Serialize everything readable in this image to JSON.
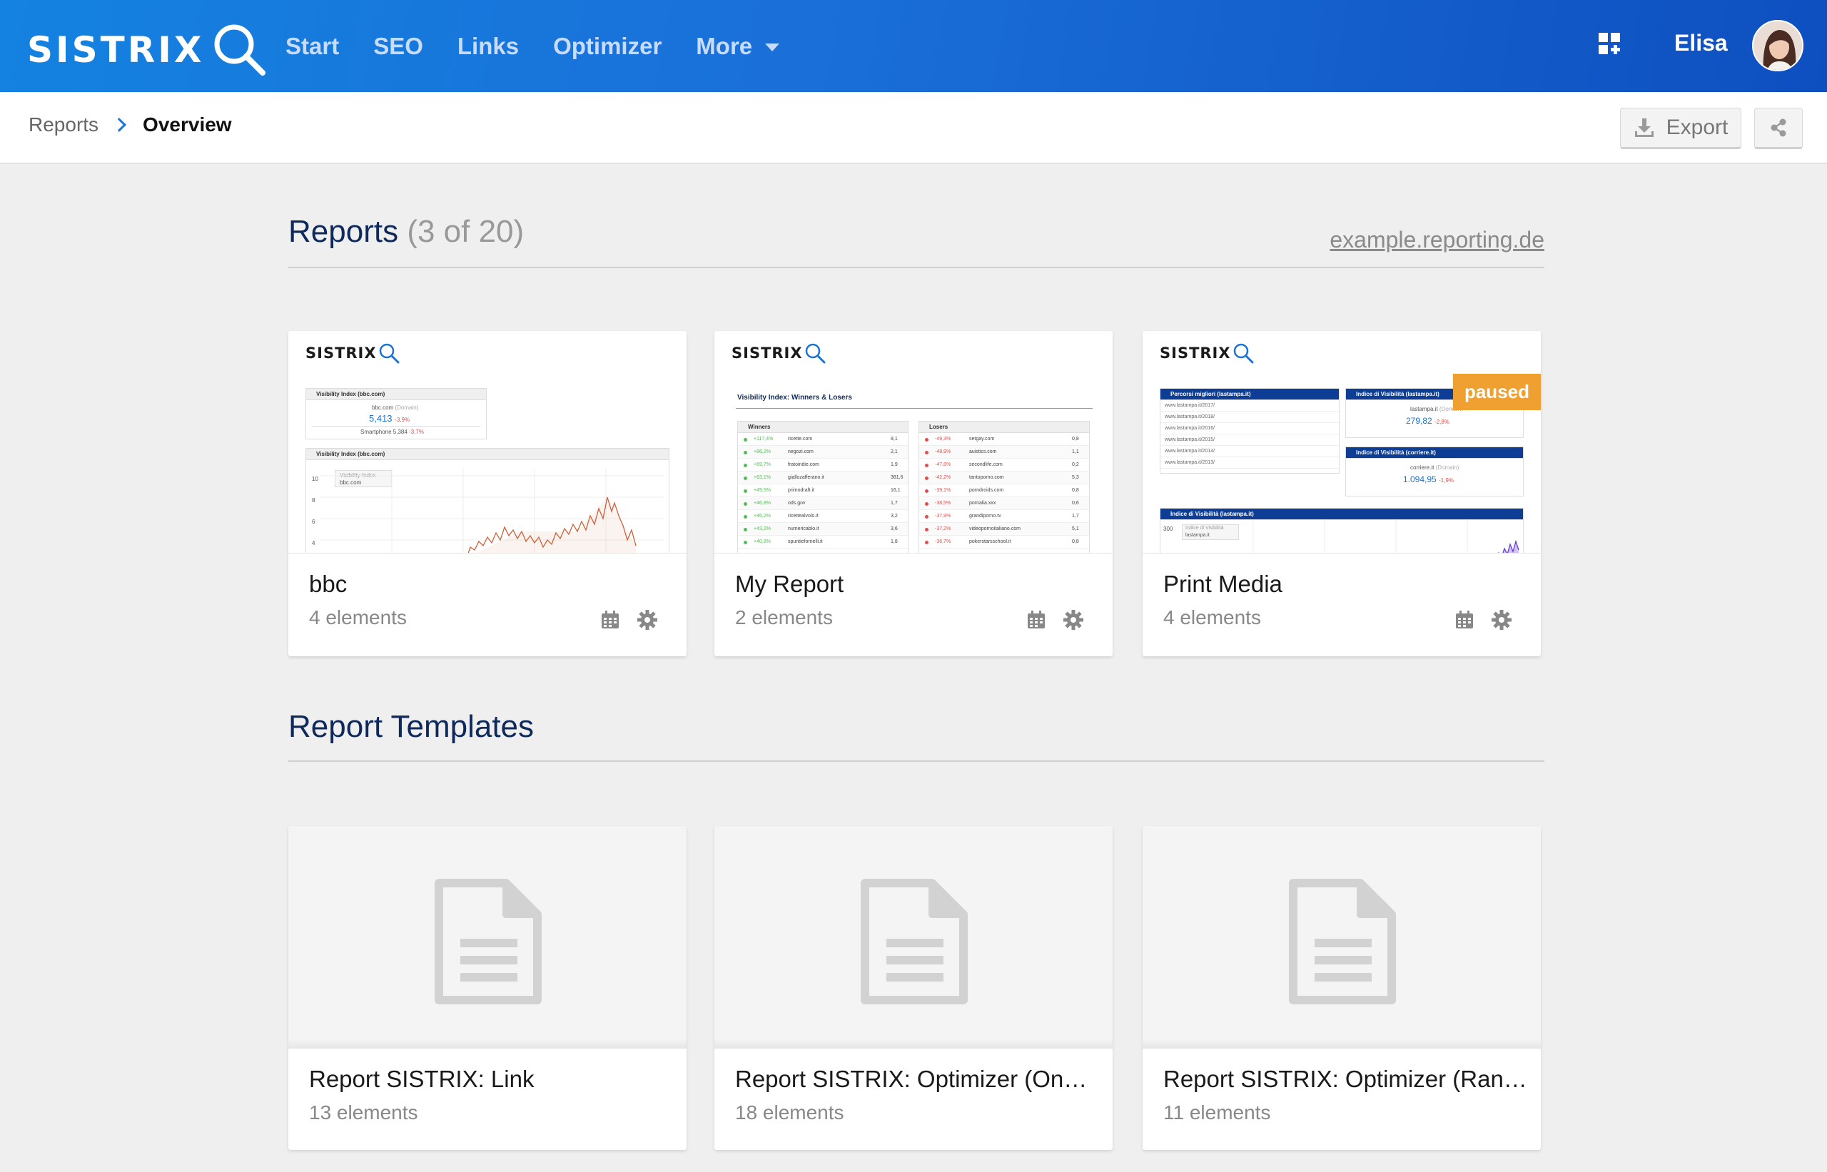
{
  "header": {
    "logo_text": "SISTRIX",
    "nav": [
      {
        "label": "Start"
      },
      {
        "label": "SEO"
      },
      {
        "label": "Links"
      },
      {
        "label": "Optimizer"
      },
      {
        "label": "More"
      }
    ],
    "user_name": "Elisa",
    "colors": {
      "gradient_start": "#1482e0",
      "gradient_end": "#0e4fc0"
    }
  },
  "breadcrumb": {
    "parent": "Reports",
    "current": "Overview"
  },
  "toolbar": {
    "export_label": "Export"
  },
  "reports_section": {
    "title": "Reports",
    "count": "(3 of 20)",
    "domain_link": "example.reporting.de",
    "cards": [
      {
        "title": "bbc",
        "subtitle": "4 elements",
        "thumb_logo": "SISTRIX"
      },
      {
        "title": "My Report",
        "subtitle": "2 elements",
        "thumb_logo": "SISTRIX"
      },
      {
        "title": "Print Media",
        "subtitle": "4 elements",
        "thumb_logo": "SISTRIX",
        "badge": "paused"
      }
    ]
  },
  "templates_section": {
    "title": "Report Templates",
    "cards": [
      {
        "title": "Report SISTRIX: Link",
        "subtitle": "13 elements"
      },
      {
        "title": "Report SISTRIX: Optimizer (Onpa…",
        "subtitle": "18 elements"
      },
      {
        "title": "Report SISTRIX: Optimizer (Ranki…",
        "subtitle": "11 elements"
      }
    ]
  },
  "thumbs": {
    "bbc": {
      "vi_header": "Visibility Index (bbc.com)",
      "domain": "bbc.com",
      "domain_note": "(Domain)",
      "value": "5,413",
      "change": "-3,9%",
      "smartphone": "Smartphone 5,384",
      "smartphone_change": "-3,7%",
      "chart_header": "Visibility Index (bbc.com)",
      "legend_title": "Visibility Index",
      "legend_series": "bbc.com",
      "y_ticks": [
        "10",
        "8",
        "6",
        "4"
      ]
    },
    "my_report": {
      "title": "Visibility Index: Winners & Losers",
      "winners_label": "Winners",
      "losers_label": "Losers",
      "winners": [
        [
          "+117,4%",
          "ricette.com",
          "8,1"
        ],
        [
          "+86,2%",
          "negozi.com",
          "2,1"
        ],
        [
          "+69,7%",
          "fratoindie.com",
          "1,9"
        ],
        [
          "+63,1%",
          "giallozafferano.it",
          "381,6"
        ],
        [
          "+49,5%",
          "primodraft.it",
          "16,1"
        ],
        [
          "+46,8%",
          "ods.gov",
          "1,7"
        ],
        [
          "+46,2%",
          "ricettealvolo.it",
          "3,2"
        ],
        [
          "+43,2%",
          "numericablo.it",
          "3,6"
        ],
        [
          "+40,8%",
          "spuntiefornelli.it",
          "1,8"
        ]
      ],
      "losers": [
        [
          "-49,3%",
          "setgay.com",
          "0,8"
        ],
        [
          "-48,9%",
          "auistics.com",
          "1,1"
        ],
        [
          "-47,8%",
          "secondlife.com",
          "0,2"
        ],
        [
          "-42,2%",
          "tantoporno.com",
          "5,3"
        ],
        [
          "-39,1%",
          "porndroids.com",
          "0,8"
        ],
        [
          "-38,5%",
          "pornalia.xxx",
          "0,6"
        ],
        [
          "-37,9%",
          "grandiporno.tv",
          "1,7"
        ],
        [
          "-37,2%",
          "videopornoitaliano.com",
          "5,1"
        ],
        [
          "-36,7%",
          "pokerstarsschool.it",
          "0,8"
        ]
      ]
    },
    "print_media": {
      "list_header": "Percorsi migliori (lastampa.it)",
      "list_rows": [
        "www.lastampa.it/2017/",
        "www.lastampa.it/2018/",
        "www.lastampa.it/2016/",
        "www.lastampa.it/2015/",
        "www.lastampa.it/2014/",
        "www.lastampa.it/2013/"
      ],
      "vi1_header": "Indice di Visibilità (lastampa.it)",
      "vi1_domain": "lastampa.it",
      "vi1_note": "(Domain)",
      "vi1_value": "279,82",
      "vi1_change": "-2,8%",
      "vi2_header": "Indice di Visibilità (corriere.it)",
      "vi2_domain": "corriere.it",
      "vi2_note": "(Domain)",
      "vi2_value": "1.094,95",
      "vi2_change": "-1,9%",
      "chart_header": "Indice di Visibilità (lastampa.it)",
      "chart_y": "300",
      "legend_title": "Indice di Visibilità",
      "legend_series": "lastampa.it"
    }
  }
}
